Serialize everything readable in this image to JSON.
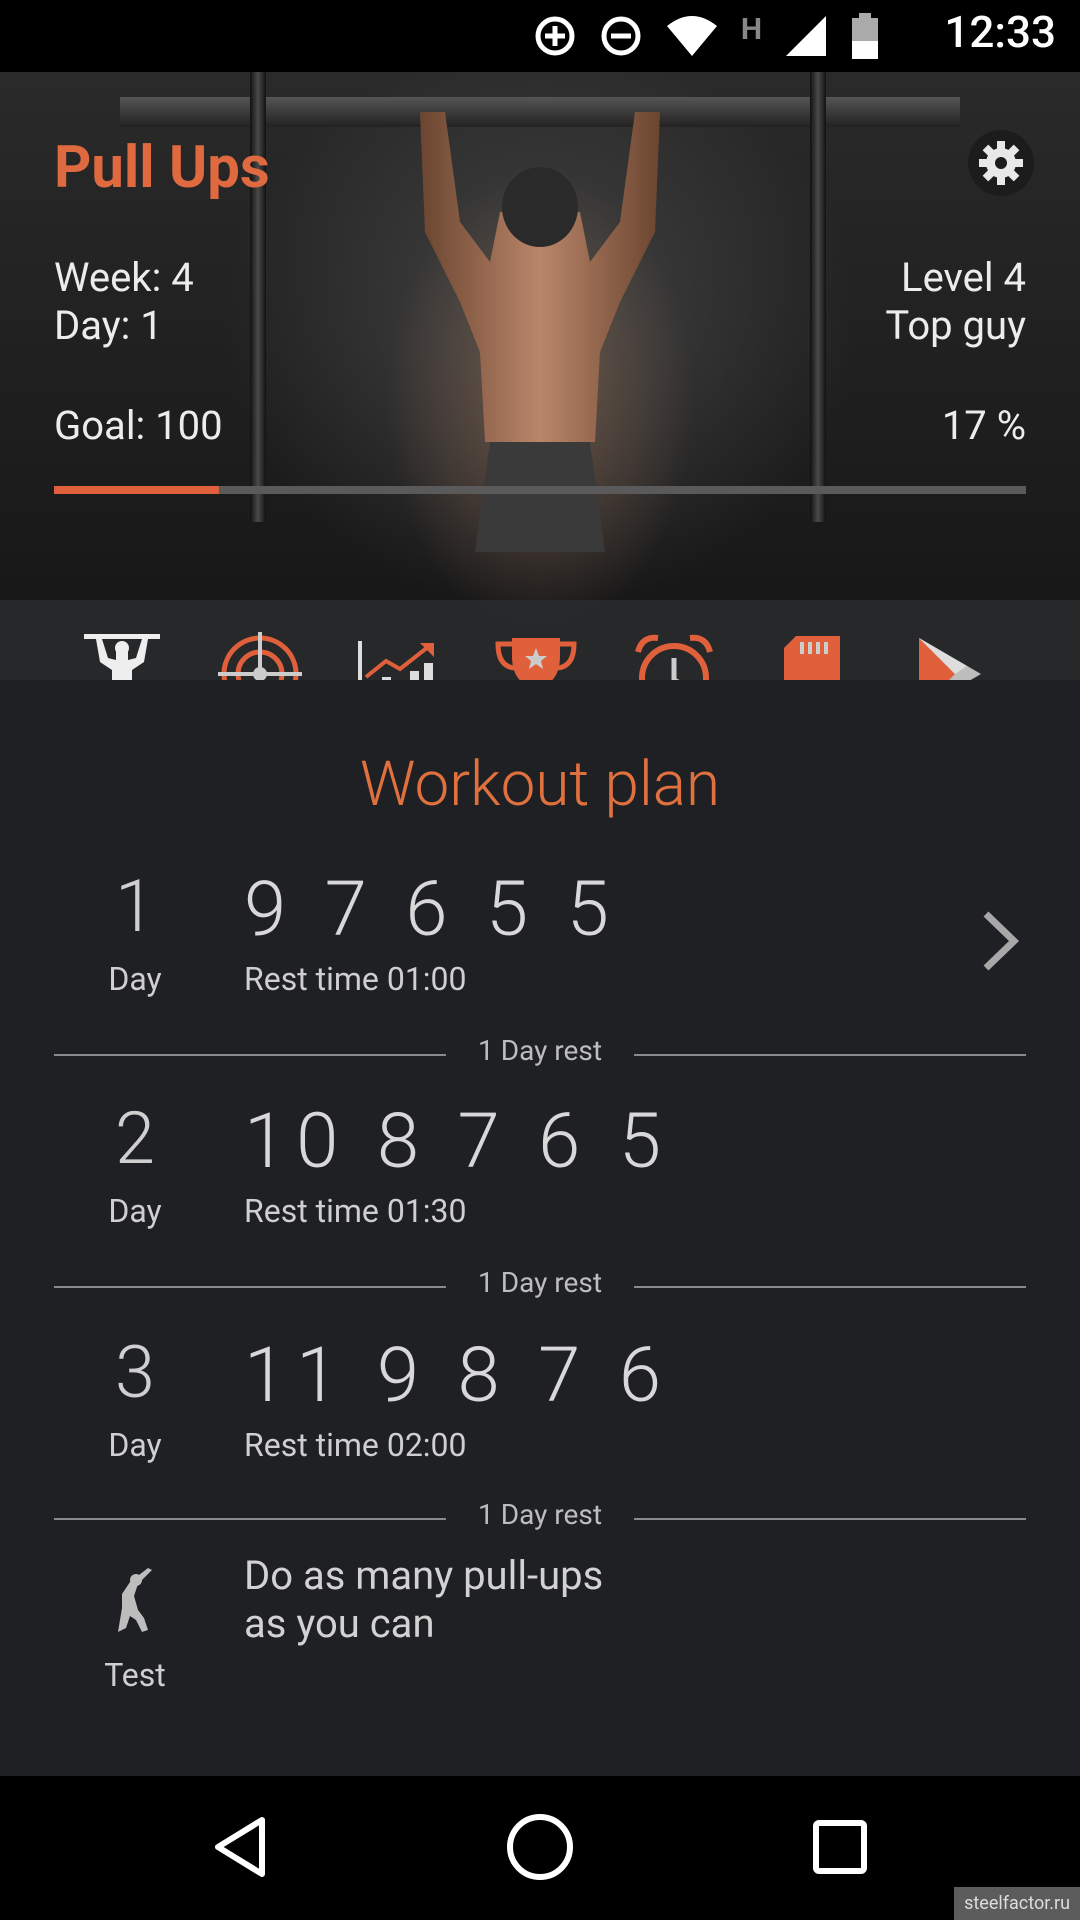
{
  "status_bar": {
    "time": "12:33",
    "network_letter": "H"
  },
  "header": {
    "title": "Pull Ups",
    "week": "Week: 4",
    "day": "Day: 1",
    "level": "Level 4",
    "rank": "Top guy",
    "goal": "Goal: 100",
    "percent": "17 %",
    "progress_fraction": 0.17
  },
  "tabs": [
    {
      "name": "workout"
    },
    {
      "name": "target"
    },
    {
      "name": "statistics"
    },
    {
      "name": "achievements"
    },
    {
      "name": "timer"
    },
    {
      "name": "backup"
    },
    {
      "name": "play"
    }
  ],
  "plan": {
    "title": "Workout plan",
    "days": [
      {
        "number": "1",
        "label": "Day",
        "reps": "9 7 6 5 5",
        "rest": "Rest time 01:00"
      },
      {
        "number": "2",
        "label": "Day",
        "reps": "10 8 7 6 5",
        "rest": "Rest time 01:30"
      },
      {
        "number": "3",
        "label": "Day",
        "reps": "11 9 8 7 6",
        "rest": "Rest time 02:00"
      }
    ],
    "rest_label": "1 Day rest",
    "test": {
      "label": "Test",
      "description_line1": "Do as many pull-ups",
      "description_line2": "as you can"
    }
  },
  "watermark": "steelfactor.ru",
  "colors": {
    "accent": "#e0603c",
    "background": "#1e2023"
  }
}
